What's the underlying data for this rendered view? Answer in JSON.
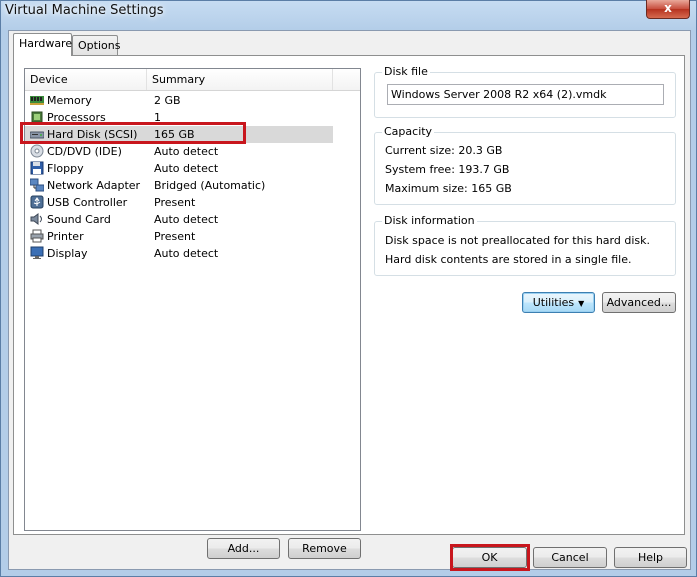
{
  "window": {
    "title": "Virtual Machine Settings",
    "close_label": "x"
  },
  "tabs": [
    {
      "label": "Hardware"
    },
    {
      "label": "Options"
    }
  ],
  "device_list": {
    "columns": {
      "device": "Device",
      "summary": "Summary"
    },
    "rows": [
      {
        "icon": "memory-icon",
        "device": "Memory",
        "summary": "2 GB"
      },
      {
        "icon": "processor-icon",
        "device": "Processors",
        "summary": "1"
      },
      {
        "icon": "hard-disk-icon",
        "device": "Hard Disk (SCSI)",
        "summary": "165 GB",
        "selected": true
      },
      {
        "icon": "cd-dvd-icon",
        "device": "CD/DVD (IDE)",
        "summary": "Auto detect"
      },
      {
        "icon": "floppy-icon",
        "device": "Floppy",
        "summary": "Auto detect"
      },
      {
        "icon": "network-adapter-icon",
        "device": "Network Adapter",
        "summary": "Bridged (Automatic)"
      },
      {
        "icon": "usb-controller-icon",
        "device": "USB Controller",
        "summary": "Present"
      },
      {
        "icon": "sound-card-icon",
        "device": "Sound Card",
        "summary": "Auto detect"
      },
      {
        "icon": "printer-icon",
        "device": "Printer",
        "summary": "Present"
      },
      {
        "icon": "display-icon",
        "device": "Display",
        "summary": "Auto detect"
      }
    ]
  },
  "list_buttons": {
    "add": "Add...",
    "remove": "Remove"
  },
  "disk_file": {
    "title": "Disk file",
    "value": "Windows Server 2008 R2 x64 (2).vmdk"
  },
  "capacity": {
    "title": "Capacity",
    "current": "Current size: 20.3 GB",
    "system_free": "System free: 193.7 GB",
    "maximum": "Maximum size: 165 GB"
  },
  "disk_info": {
    "title": "Disk information",
    "line1": "Disk space is not preallocated for this hard disk.",
    "line2": "Hard disk contents are stored in a single file."
  },
  "disk_buttons": {
    "utilities": "Utilities",
    "advanced": "Advanced..."
  },
  "dialog_buttons": {
    "ok": "OK",
    "cancel": "Cancel",
    "help": "Help"
  },
  "highlight_color": "#c8161d"
}
